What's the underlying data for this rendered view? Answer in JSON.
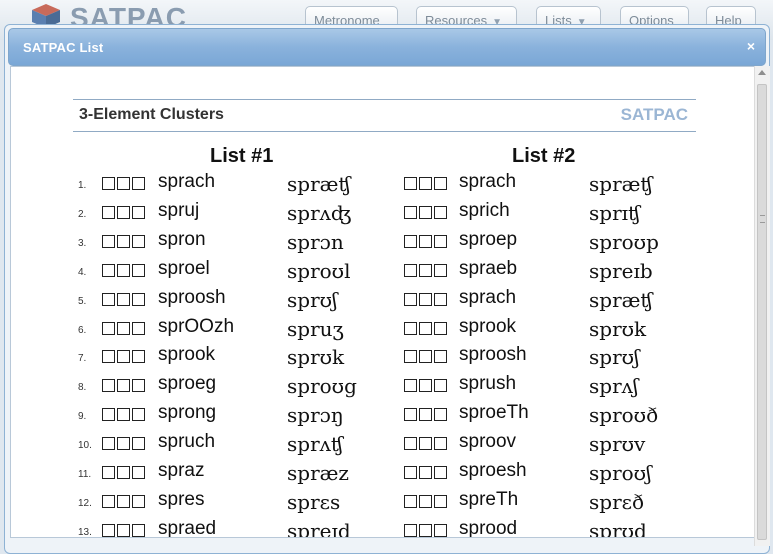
{
  "app": {
    "brand": "SATPAC",
    "nav": [
      {
        "label": "Metronome",
        "dropdown": false
      },
      {
        "label": "Resources",
        "dropdown": true
      },
      {
        "label": "Lists",
        "dropdown": true
      },
      {
        "label": "Options",
        "dropdown": false
      },
      {
        "label": "Help",
        "dropdown": false
      }
    ]
  },
  "dialog": {
    "title": "SATPAC List",
    "close": "×"
  },
  "document": {
    "heading": "3-Element Clusters",
    "logo": "SATPAC",
    "list1": {
      "title": "List #1",
      "items": [
        {
          "num": "1.",
          "word": "sprach",
          "ipa": "spræʧ"
        },
        {
          "num": "2.",
          "word": "spruj",
          "ipa": "sprʌʤ"
        },
        {
          "num": "3.",
          "word": "spron",
          "ipa": "sprɔn"
        },
        {
          "num": "4.",
          "word": "sproel",
          "ipa": "sproʊl"
        },
        {
          "num": "5.",
          "word": "sproosh",
          "ipa": "sprʊʃ"
        },
        {
          "num": "6.",
          "word": "sprOOzh",
          "ipa": "spruʒ"
        },
        {
          "num": "7.",
          "word": "sprook",
          "ipa": "sprʊk"
        },
        {
          "num": "8.",
          "word": "sproeg",
          "ipa": "sproʊg"
        },
        {
          "num": "9.",
          "word": "sprong",
          "ipa": "sprɔŋ"
        },
        {
          "num": "10.",
          "word": "spruch",
          "ipa": "sprʌʧ"
        },
        {
          "num": "11.",
          "word": "spraz",
          "ipa": "spræz"
        },
        {
          "num": "12.",
          "word": "spres",
          "ipa": "sprɛs"
        },
        {
          "num": "13.",
          "word": "spraed",
          "ipa": "spreɪd"
        }
      ]
    },
    "list2": {
      "title": "List #2",
      "items": [
        {
          "word": "sprach",
          "ipa": "spræʧ"
        },
        {
          "word": "sprich",
          "ipa": "sprɪʧ"
        },
        {
          "word": "sproep",
          "ipa": "sproʊp"
        },
        {
          "word": "spraeb",
          "ipa": "spreɪb"
        },
        {
          "word": "sprach",
          "ipa": "spræʧ"
        },
        {
          "word": "sprook",
          "ipa": "sprʊk"
        },
        {
          "word": "sproosh",
          "ipa": "sprʊʃ"
        },
        {
          "word": "sprush",
          "ipa": "sprʌʃ"
        },
        {
          "word": "sproeTh",
          "ipa": "sproʊð"
        },
        {
          "word": "sproov",
          "ipa": "sprʊv"
        },
        {
          "word": "sproesh",
          "ipa": "sproʊʃ"
        },
        {
          "word": "spreTh",
          "ipa": "sprɛð"
        },
        {
          "word": "sprood",
          "ipa": "sprʊd"
        }
      ]
    }
  }
}
